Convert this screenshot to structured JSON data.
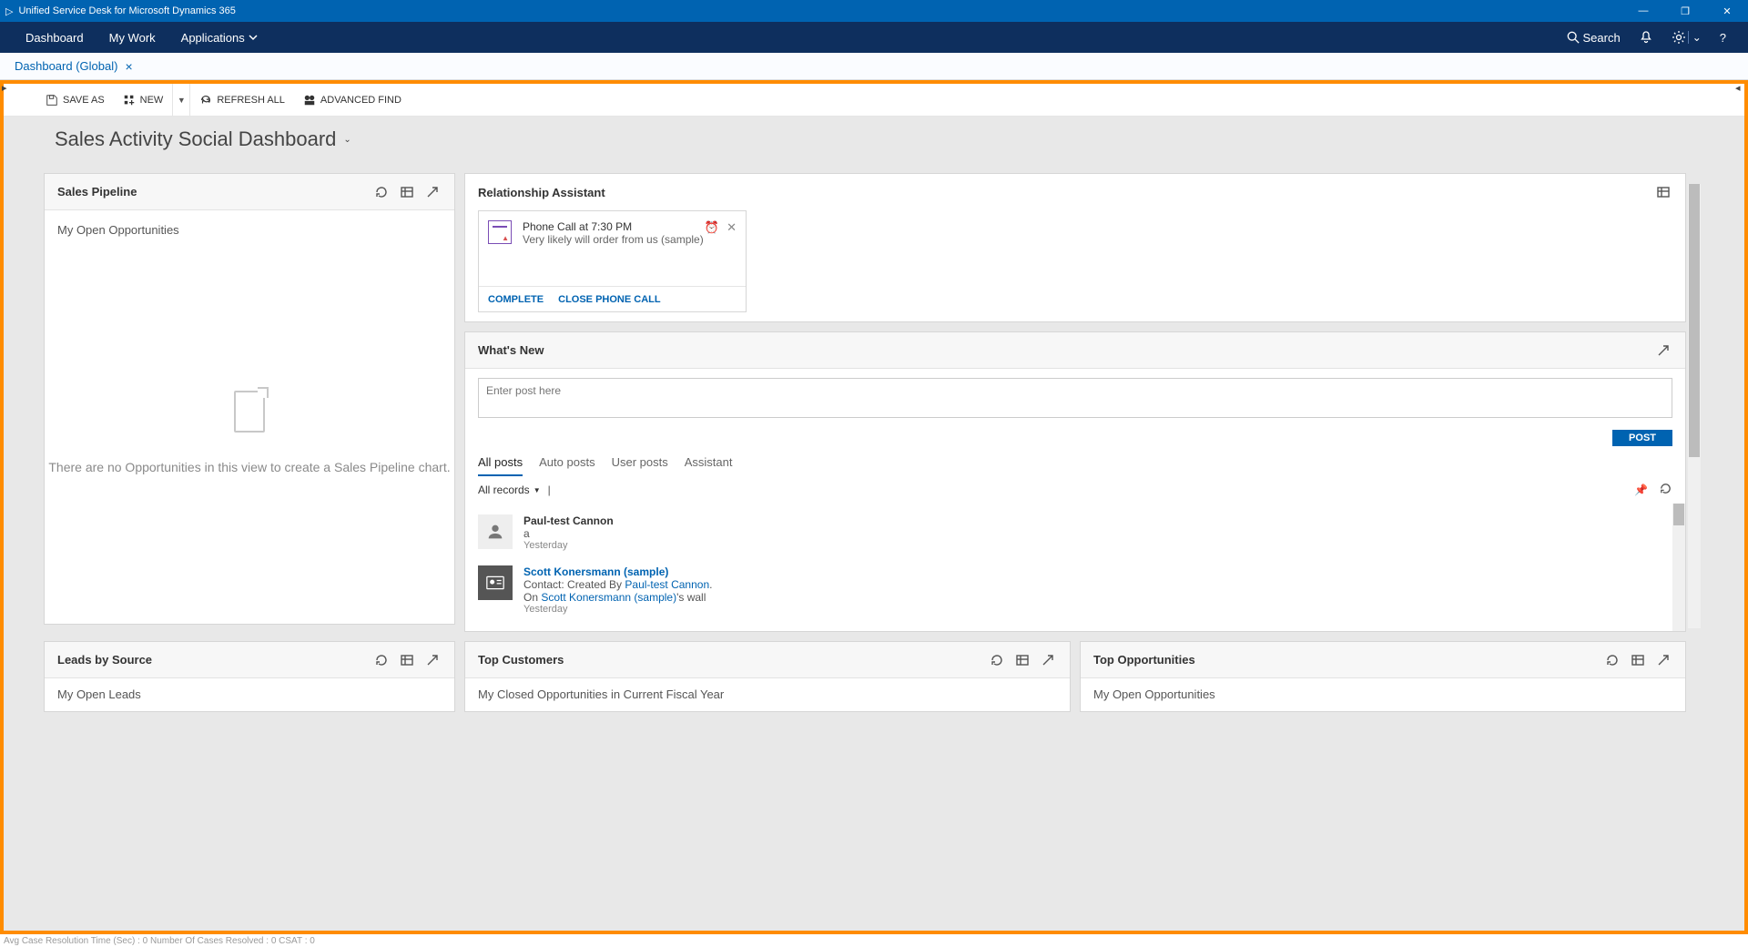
{
  "titlebar": {
    "title": "Unified Service Desk for Microsoft Dynamics 365"
  },
  "nav": {
    "items": [
      "Dashboard",
      "My Work",
      "Applications"
    ],
    "search": "Search"
  },
  "tab": {
    "label": "Dashboard (Global)"
  },
  "toolbar": {
    "save_as": "SAVE AS",
    "new": "NEW",
    "refresh": "REFRESH ALL",
    "advanced_find": "ADVANCED FIND"
  },
  "dashboard": {
    "title": "Sales Activity Social Dashboard"
  },
  "pipeline": {
    "title": "Sales Pipeline",
    "subtitle": "My Open Opportunities",
    "empty": "There are no Opportunities in this view to create a Sales Pipeline chart."
  },
  "assistant": {
    "title": "Relationship Assistant",
    "card": {
      "title": "Phone Call at 7:30 PM",
      "subtitle": "Very likely will order from us (sample)",
      "complete": "COMPLETE",
      "close": "CLOSE PHONE CALL"
    }
  },
  "whatsnew": {
    "title": "What's New",
    "placeholder": "Enter post here",
    "post": "POST",
    "tabs": [
      "All posts",
      "Auto posts",
      "User posts",
      "Assistant"
    ],
    "filter": "All records",
    "posts": [
      {
        "name": "Paul-test Cannon",
        "line1": "a",
        "time": "Yesterday"
      },
      {
        "name": "Scott Konersmann (sample)",
        "pre": "Contact: Created By ",
        "link1": "Paul-test Cannon",
        "post1": ".",
        "pre2": "On ",
        "link2": "Scott Konersmann (sample)",
        "post2": "'s wall",
        "time": "Yesterday"
      }
    ]
  },
  "bottom": {
    "leads": {
      "title": "Leads by Source",
      "sub": "My Open Leads"
    },
    "customers": {
      "title": "Top Customers",
      "sub": "My Closed Opportunities in Current Fiscal Year"
    },
    "opps": {
      "title": "Top Opportunities",
      "sub": "My Open Opportunities"
    }
  },
  "status": "Avg Case Resolution Time (Sec) :   0   Number Of Cases Resolved :   0   CSAT :   0"
}
